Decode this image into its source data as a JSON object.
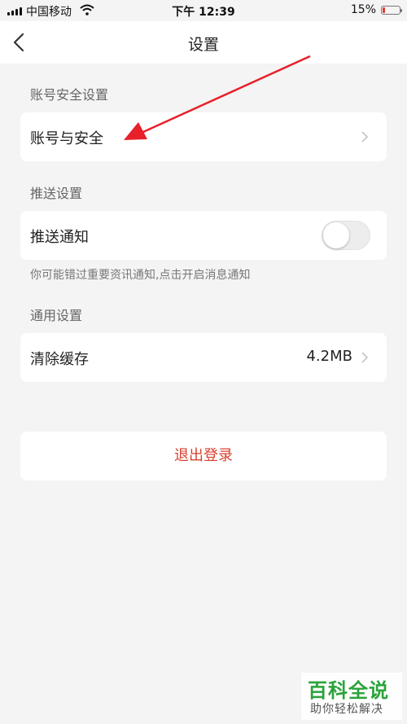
{
  "status_bar": {
    "carrier": "中国移动",
    "time": "下午 12:39",
    "battery_percent_text": "15%",
    "battery_level": 0.15,
    "battery_color": "#e03a2e"
  },
  "nav": {
    "title": "设置",
    "back_icon": "chevron-left-icon"
  },
  "sections": {
    "account": {
      "title": "账号安全设置",
      "item_label": "账号与安全"
    },
    "push": {
      "title": "推送设置",
      "item_label": "推送通知",
      "toggle_on": false,
      "hint": "你可能错过重要资讯通知,点击开启消息通知"
    },
    "general": {
      "title": "通用设置",
      "item_label": "清除缓存",
      "cache_size": "4.2MB"
    }
  },
  "logout": {
    "label": "退出登录",
    "color": "#d8412f"
  },
  "annotation": {
    "arrow_color": "#e8202a"
  },
  "watermark": {
    "main": "百科全说",
    "sub": "助你轻松解决",
    "main_color": "#2aa33a"
  }
}
